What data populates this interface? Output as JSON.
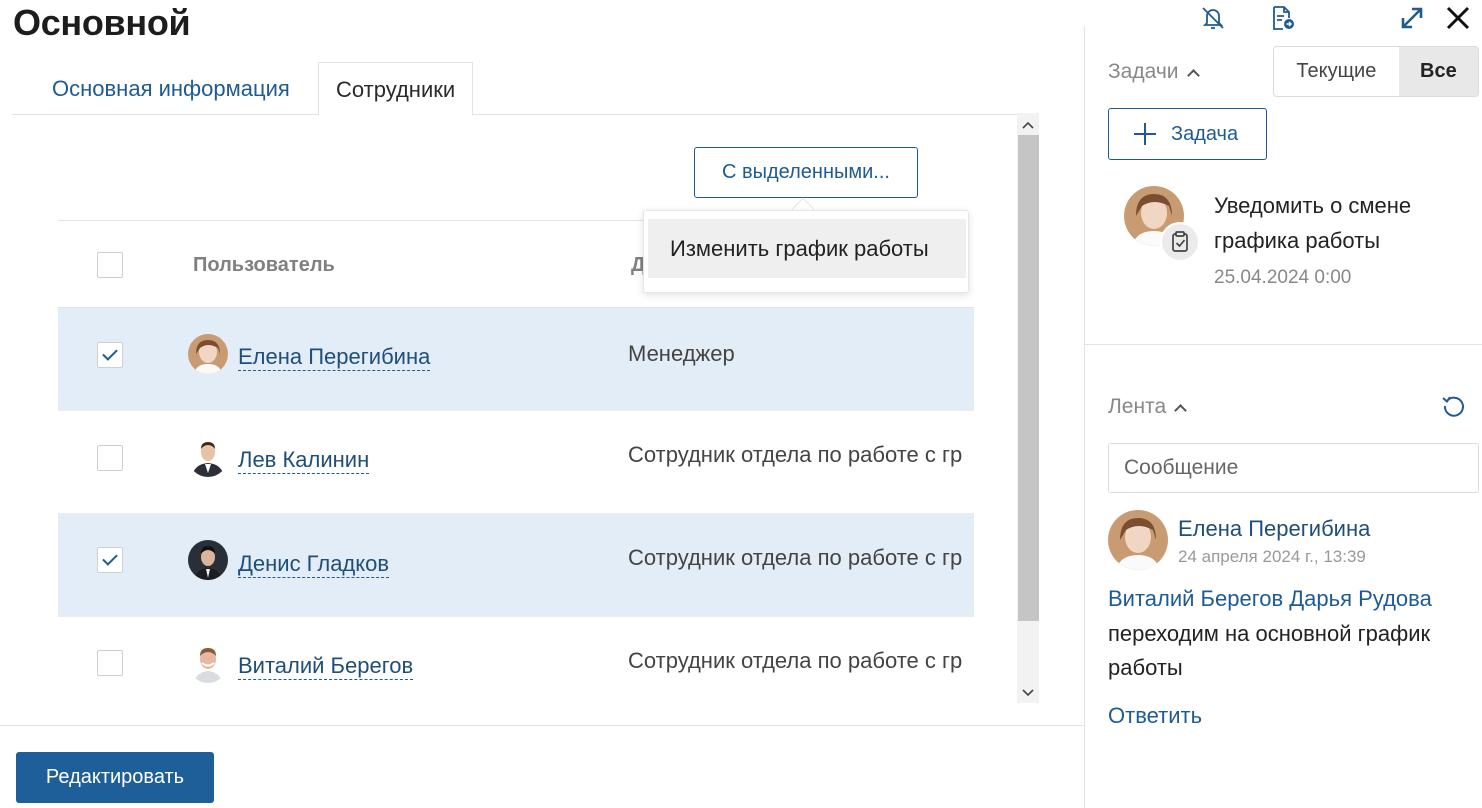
{
  "page": {
    "title": "Основной"
  },
  "tabs": [
    {
      "label": "Основная информация",
      "active": false
    },
    {
      "label": "Сотрудники",
      "active": true
    }
  ],
  "toolbar": {
    "with_selected_label": "С выделенными..."
  },
  "dropdown": {
    "items": [
      {
        "label": "Изменить график работы"
      }
    ]
  },
  "table": {
    "headers": {
      "user": "Пользователь",
      "position": "Д"
    },
    "rows": [
      {
        "name": "Елена Перегибина",
        "position": "Менеджер",
        "checked": true
      },
      {
        "name": "Лев Калинин",
        "position": "Сотрудник отдела по работе с гр",
        "checked": false
      },
      {
        "name": "Денис Гладков",
        "position": "Сотрудник отдела по работе с гр",
        "checked": true
      },
      {
        "name": "Виталий Берегов",
        "position": "Сотрудник отдела по работе с гр",
        "checked": false
      }
    ]
  },
  "footer": {
    "edit_label": "Редактировать"
  },
  "window_icons": [
    "bell-off-icon",
    "document-export-icon",
    "expand-icon",
    "close-icon"
  ],
  "tasks": {
    "title": "Задачи",
    "filter": {
      "current": "Текущие",
      "all": "Все",
      "selected": "all"
    },
    "add_label": "Задача",
    "item": {
      "title": "Уведомить о смене графика работы",
      "date": "25.04.2024 0:00"
    }
  },
  "feed": {
    "title": "Лента",
    "message_placeholder": "Сообщение",
    "post": {
      "author": "Елена Перегибина",
      "date": "24 апреля 2024 г., 13:39",
      "mentions": "Виталий Берегов Дарья Рудова",
      "text": "переходим на основной график работы",
      "reply_label": "Ответить"
    }
  },
  "colors": {
    "accent": "#1f5b93",
    "selected_row": "#e2edf7",
    "primary_button": "#1e5f99"
  }
}
